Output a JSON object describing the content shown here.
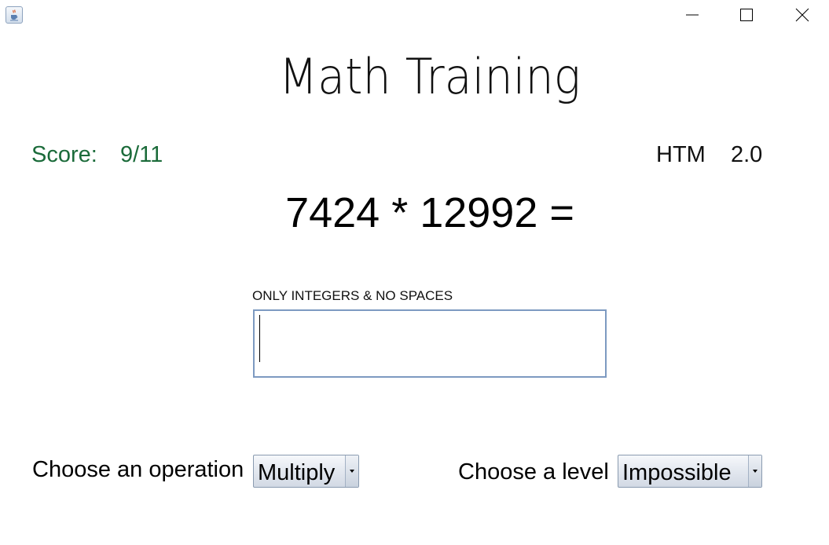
{
  "window": {
    "icon": "java-cup-icon",
    "controls": [
      "minimize-icon",
      "maximize-icon",
      "close-icon"
    ]
  },
  "title": "Math Training",
  "score": {
    "label": "Score:",
    "value": "9/11"
  },
  "version": {
    "name": "HTM",
    "number": "2.0"
  },
  "equation": "7424 * 12992 =",
  "answer": {
    "hint": "ONLY INTEGERS & NO SPACES",
    "value": ""
  },
  "operation": {
    "label": "Choose an operation",
    "selected": "Multiply"
  },
  "level": {
    "label": "Choose a level",
    "selected": "Impossible"
  },
  "colors": {
    "score": "#1b6b3a",
    "input_border": "#7d9ac1"
  }
}
